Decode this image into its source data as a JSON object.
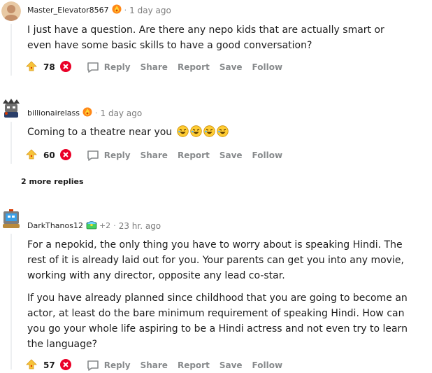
{
  "comments": [
    {
      "author": "Master_Elevator8567",
      "award_icon": "fire-award-icon",
      "time": "1 day ago",
      "body": [
        "I just have a question. Are there any nepo kids that are actually smart or even have some basic skills to have a good conversation?"
      ],
      "score": "78",
      "actions": [
        "Reply",
        "Share",
        "Report",
        "Save",
        "Follow"
      ]
    },
    {
      "author": "billionairelass",
      "award_icon": "fire-award-icon",
      "time": "1 day ago",
      "body_text": "Coming to a theatre near you",
      "emojis": [
        "laughing-face-icon",
        "laughing-face-icon",
        "laughing-face-icon",
        "laughing-face-icon"
      ],
      "score": "60",
      "actions": [
        "Reply",
        "Share",
        "Report",
        "Save",
        "Follow"
      ]
    },
    {
      "author": "DarkThanos12",
      "award_icon": "treasure-award-icon",
      "extra_awards": "+2",
      "time": "23 hr. ago",
      "body": [
        "For a nepokid, the only thing you have to worry about is speaking Hindi. The rest of it is already laid out for you. Your parents can get you into any movie, working with any director, opposite any lead co-star.",
        "If you have already planned since childhood that you are going to become an actor, at least do the bare minimum requirement of speaking Hindi. How can you go your whole life aspiring to be a Hindi actress and not even try to learn the language?"
      ],
      "score": "57",
      "actions": [
        "Reply",
        "Share",
        "Report",
        "Save",
        "Follow"
      ]
    }
  ],
  "more_replies": "2 more replies",
  "colors": {
    "upvote": "#f7c338",
    "downvote": "#ea0027",
    "meta": "#7c7c7c",
    "action": "#878a8c"
  }
}
